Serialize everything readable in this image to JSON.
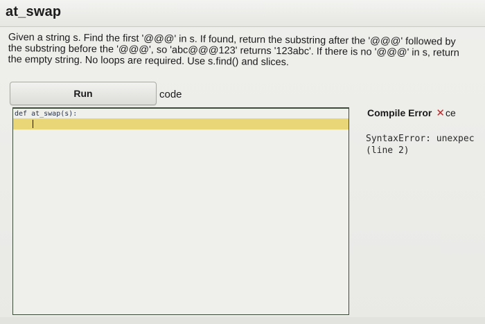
{
  "problem": {
    "title": "at_swap",
    "description": "Given a string s. Find the first '@@@' in s. If found, return the substring after the '@@@' followed by the substring before the '@@@', so 'abc@@@123' returns '123abc'. If there is no '@@@' in s, return the empty string. No loops are required. Use s.find() and slices."
  },
  "toolbar": {
    "run_label": "Run",
    "code_label": "code"
  },
  "editor": {
    "line1": "def at_swap(s):"
  },
  "result": {
    "status_label": "Compile Error",
    "close_symbol": "✕",
    "status_suffix": "ce",
    "error_line1": "SyntaxError: unexpec",
    "error_line2": "(line 2)"
  },
  "colors": {
    "active_line": "#e8d677",
    "error_x": "#c02a2a"
  }
}
